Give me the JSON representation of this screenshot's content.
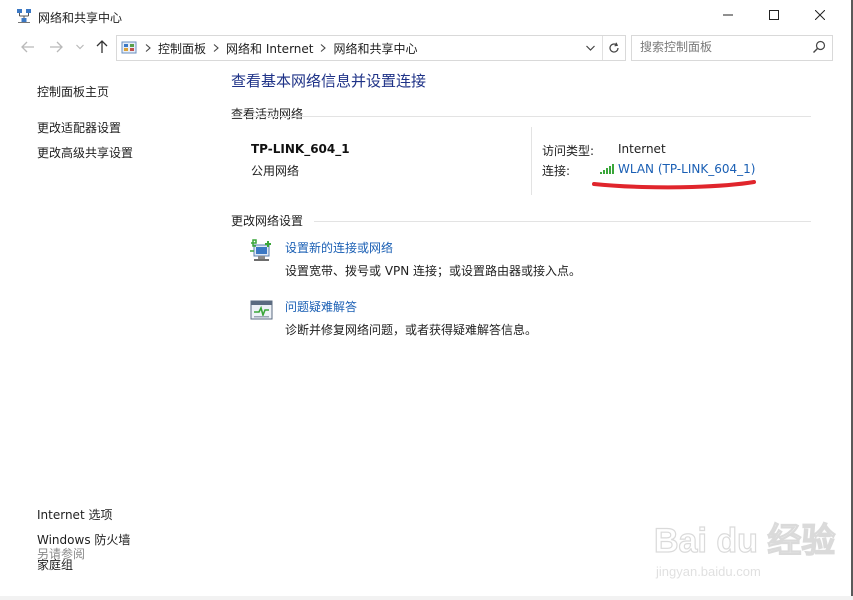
{
  "window": {
    "title": "网络和共享中心"
  },
  "address": {
    "crumbs": [
      "控制面板",
      "网络和 Internet",
      "网络和共享中心"
    ]
  },
  "search": {
    "placeholder": "搜索控制面板"
  },
  "sidebar": {
    "links": [
      "控制面板主页",
      "更改适配器设置",
      "更改高级共享设置"
    ],
    "see_also_label": "另请参阅",
    "see_also": [
      "Internet 选项",
      "Windows 防火墙",
      "家庭组"
    ]
  },
  "main": {
    "title": "查看基本网络信息并设置连接",
    "active_header": "查看活动网络",
    "network": {
      "name": "TP-LINK_604_1",
      "type": "公用网络",
      "access_label": "访问类型:",
      "access_value": "Internet",
      "connection_label": "连接:",
      "connection_link": "WLAN (TP-LINK_604_1)"
    },
    "change_header": "更改网络设置",
    "tasks": [
      {
        "link": "设置新的连接或网络",
        "desc": "设置宽带、拨号或 VPN 连接；或设置路由器或接入点。"
      },
      {
        "link": "问题疑难解答",
        "desc": "诊断并修复网络问题，或者获得疑难解答信息。"
      }
    ]
  },
  "watermark": {
    "brand": "Bai du 经验",
    "url": "jingyan.baidu.com"
  },
  "colors": {
    "link": "#1a5fb4",
    "title": "#1e3287",
    "annotation": "#e0252c"
  }
}
